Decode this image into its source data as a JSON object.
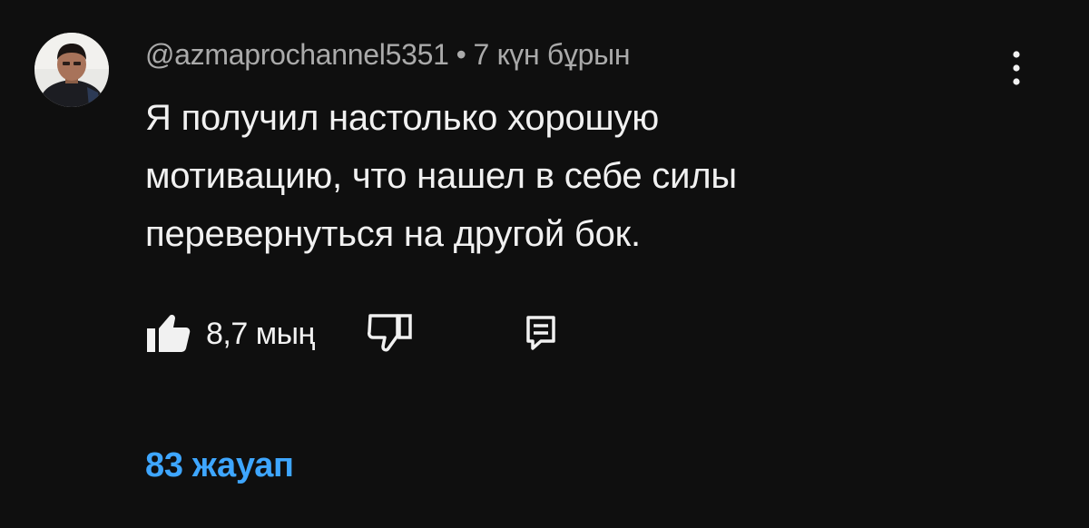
{
  "comment": {
    "author": "@azmaprochannel5351",
    "separator": "•",
    "timestamp": "7 күн бұрын",
    "text_lines": [
      "Я получил настолько хорошую",
      "мотивацию, что нашел в себе силы",
      "перевернуться на другой бок."
    ],
    "like_count": "8,7 мың",
    "replies_label": "83 жауап"
  },
  "colors": {
    "background": "#0f0f0f",
    "text": "#f1f1f1",
    "meta_text": "#aaaaaa",
    "link": "#3ea6ff"
  },
  "icons": {
    "avatar": "user-avatar",
    "menu": "more-vert-icon",
    "like": "thumb-up-filled-icon",
    "dislike": "thumb-down-outline-icon",
    "reply": "comment-reply-icon"
  }
}
